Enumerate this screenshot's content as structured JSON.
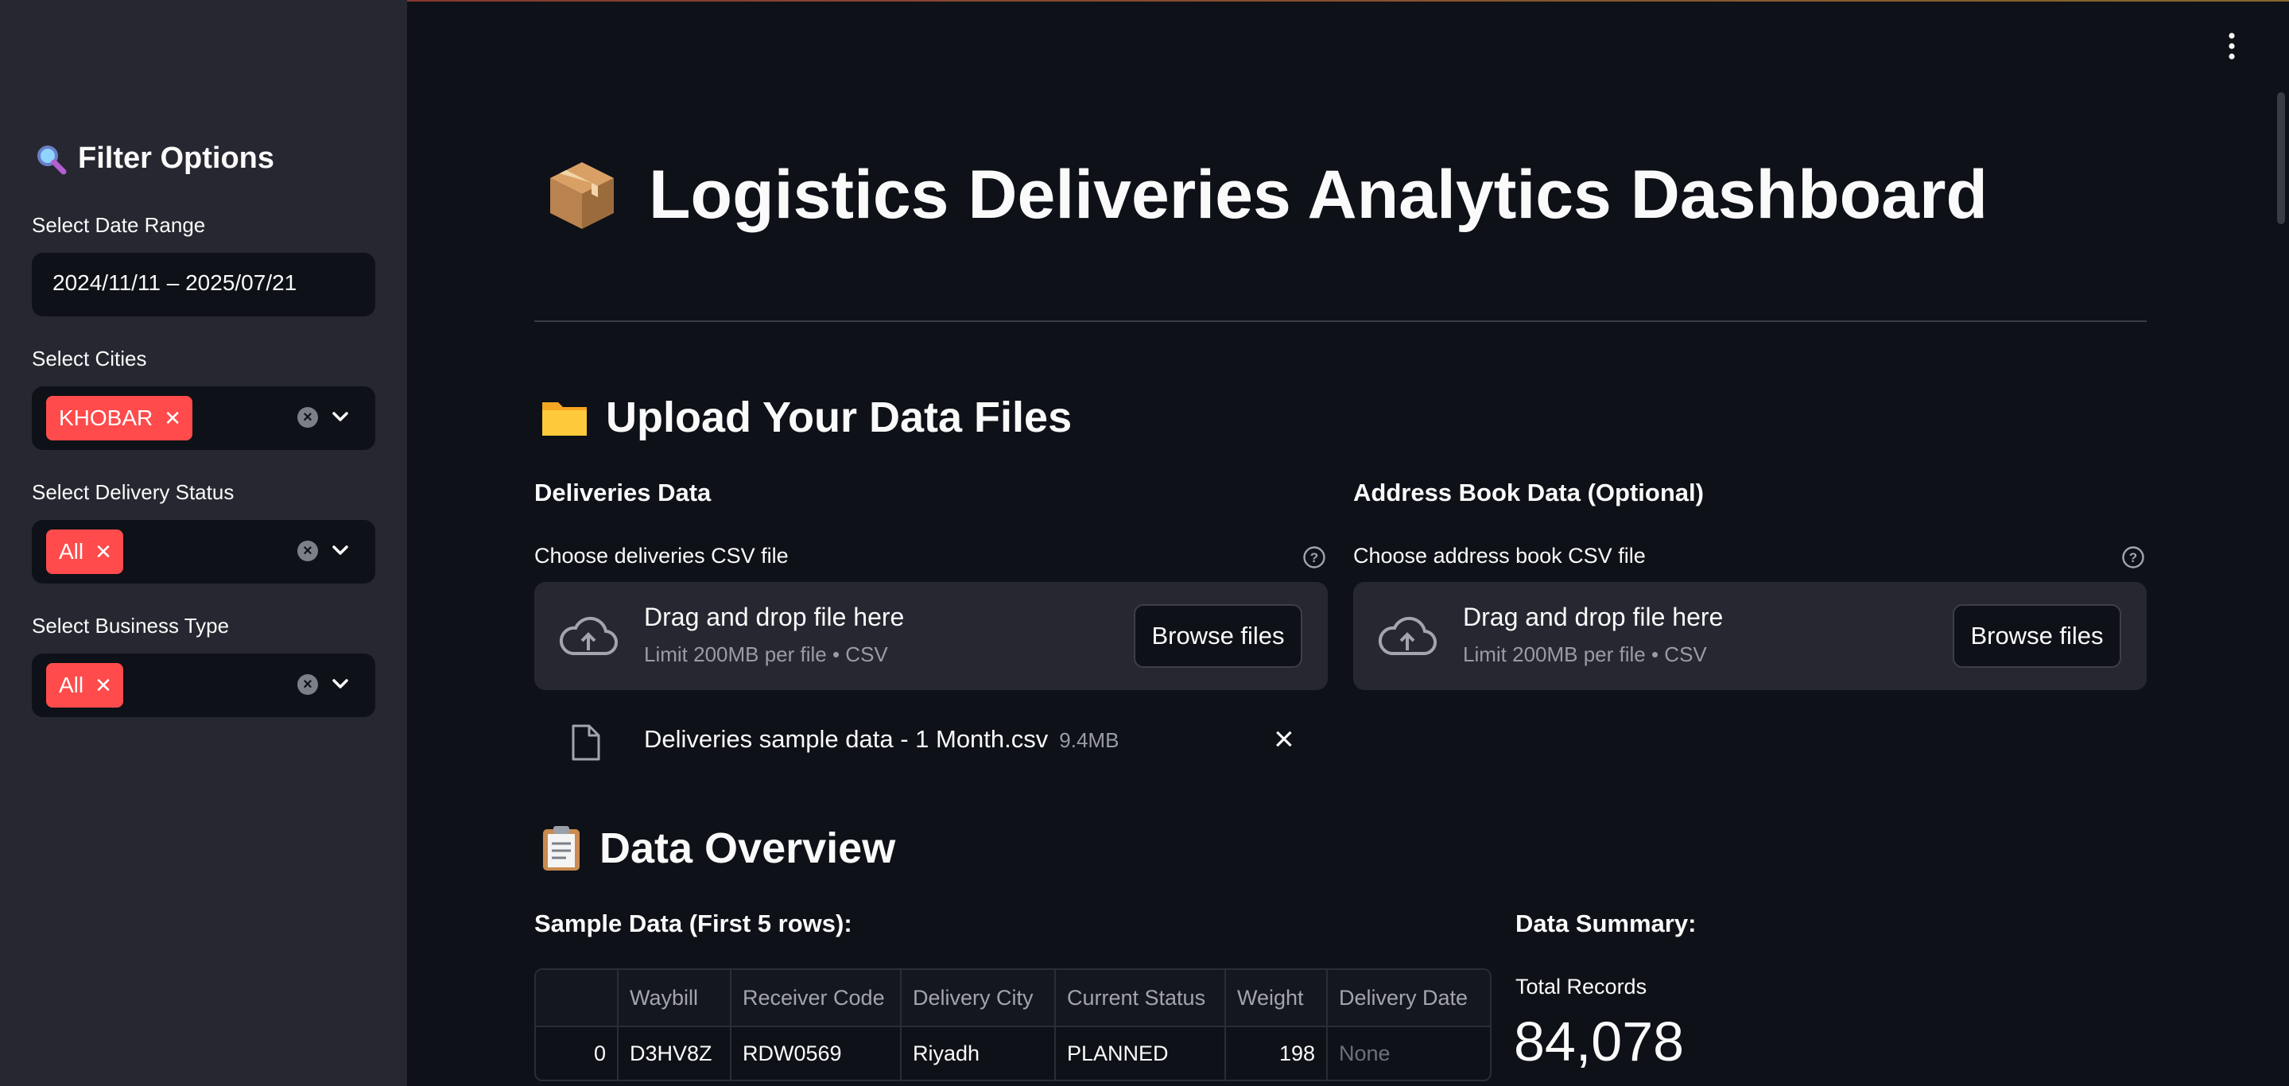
{
  "sidebar": {
    "title": "Filter Options",
    "date_range": {
      "label": "Select Date Range",
      "value": "2024/11/11 – 2025/07/21"
    },
    "cities": {
      "label": "Select Cities",
      "tag": "KHOBAR"
    },
    "delivery_status": {
      "label": "Select Delivery Status",
      "tag": "All"
    },
    "business_type": {
      "label": "Select Business Type",
      "tag": "All"
    }
  },
  "main": {
    "title": "Logistics Deliveries Analytics Dashboard",
    "upload_heading": "Upload Your Data Files",
    "deliveries": {
      "heading": "Deliveries Data",
      "label": "Choose deliveries CSV file",
      "drop_text": "Drag and drop file here",
      "limit_text": "Limit 200MB per file • CSV",
      "browse": "Browse files",
      "file_name": "Deliveries sample data - 1 Month.csv",
      "file_size": "9.4MB"
    },
    "address_book": {
      "heading": "Address Book Data (Optional)",
      "label": "Choose address book CSV file",
      "drop_text": "Drag and drop file here",
      "limit_text": "Limit 200MB per file • CSV",
      "browse": "Browse files"
    },
    "overview_heading": "Data Overview",
    "sample_heading": "Sample Data (First 5 rows):",
    "table": {
      "columns": [
        "",
        "Waybill",
        "Receiver Code",
        "Delivery City",
        "Current Status",
        "Weight",
        "Delivery Date"
      ],
      "rows": [
        [
          "0",
          "D3HV8Z",
          "RDW0569",
          "Riyadh",
          "PLANNED",
          "198",
          "None"
        ]
      ]
    },
    "summary": {
      "heading": "Data Summary:",
      "total_records_label": "Total Records",
      "total_records_value": "84,078"
    }
  }
}
